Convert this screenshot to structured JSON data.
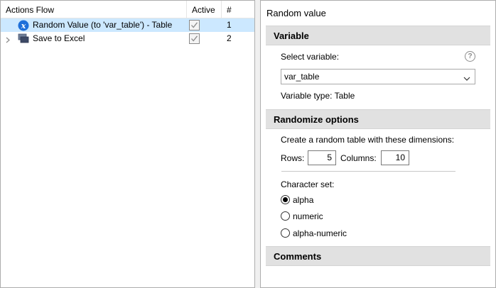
{
  "flow": {
    "columns": {
      "title": "Actions Flow",
      "active": "Active",
      "number": "#"
    },
    "rows": [
      {
        "label": "Random Value (to 'var_table') - Table",
        "active": true,
        "number": "1",
        "selected": true,
        "icon": "random-value-x-icon"
      },
      {
        "label": "Save to Excel",
        "active": true,
        "number": "2",
        "selected": false,
        "icon": "save-excel-icon"
      }
    ]
  },
  "properties": {
    "title": "Random value",
    "variable_section": {
      "header": "Variable",
      "select_label": "Select variable:",
      "selected_variable": "var_table",
      "type_text": "Variable type: Table"
    },
    "randomize_section": {
      "header": "Randomize options",
      "description": "Create a random table with these dimensions:",
      "rows_label": "Rows:",
      "rows_value": "5",
      "columns_label": "Columns:",
      "columns_value": "10",
      "charset_label": "Character set:",
      "charset_options": [
        "alpha",
        "numeric",
        "alpha-numeric"
      ],
      "charset_selected": "alpha"
    },
    "comments_section": {
      "header": "Comments"
    }
  },
  "colors": {
    "selected_row": "#cce8ff",
    "section_header": "#e1e1e1",
    "accent_icon": "#1e6fd9"
  }
}
